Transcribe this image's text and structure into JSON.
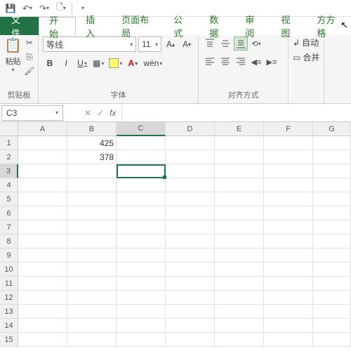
{
  "qat": {
    "save": "💾",
    "undo": "↶",
    "redo": "↷",
    "print": "🗋"
  },
  "tabs": {
    "file": "文件",
    "items": [
      "开始",
      "插入",
      "页面布局",
      "公式",
      "数据",
      "审阅",
      "视图",
      "方方格"
    ],
    "active_index": 0
  },
  "ribbon": {
    "clipboard": {
      "paste": "粘贴",
      "label": "剪贴板"
    },
    "font": {
      "name": "等线",
      "size": "11",
      "bold": "B",
      "italic": "I",
      "underline": "U",
      "wen": "wén",
      "label": "字体"
    },
    "align": {
      "label": "对齐方式"
    },
    "extra": {
      "wrap": "自动",
      "merge": "合并"
    }
  },
  "namebox": {
    "ref": "C3"
  },
  "fx": {
    "cancel": "✕",
    "confirm": "✓",
    "fx": "fx"
  },
  "columns": [
    "A",
    "B",
    "C",
    "D",
    "E",
    "F",
    "G"
  ],
  "rows": [
    "1",
    "2",
    "3",
    "4",
    "5",
    "6",
    "7",
    "8",
    "9",
    "10",
    "11",
    "12",
    "13",
    "14",
    "15"
  ],
  "cells": {
    "B1": "425",
    "B2": "378"
  },
  "selection": {
    "row": 3,
    "col": "C"
  }
}
